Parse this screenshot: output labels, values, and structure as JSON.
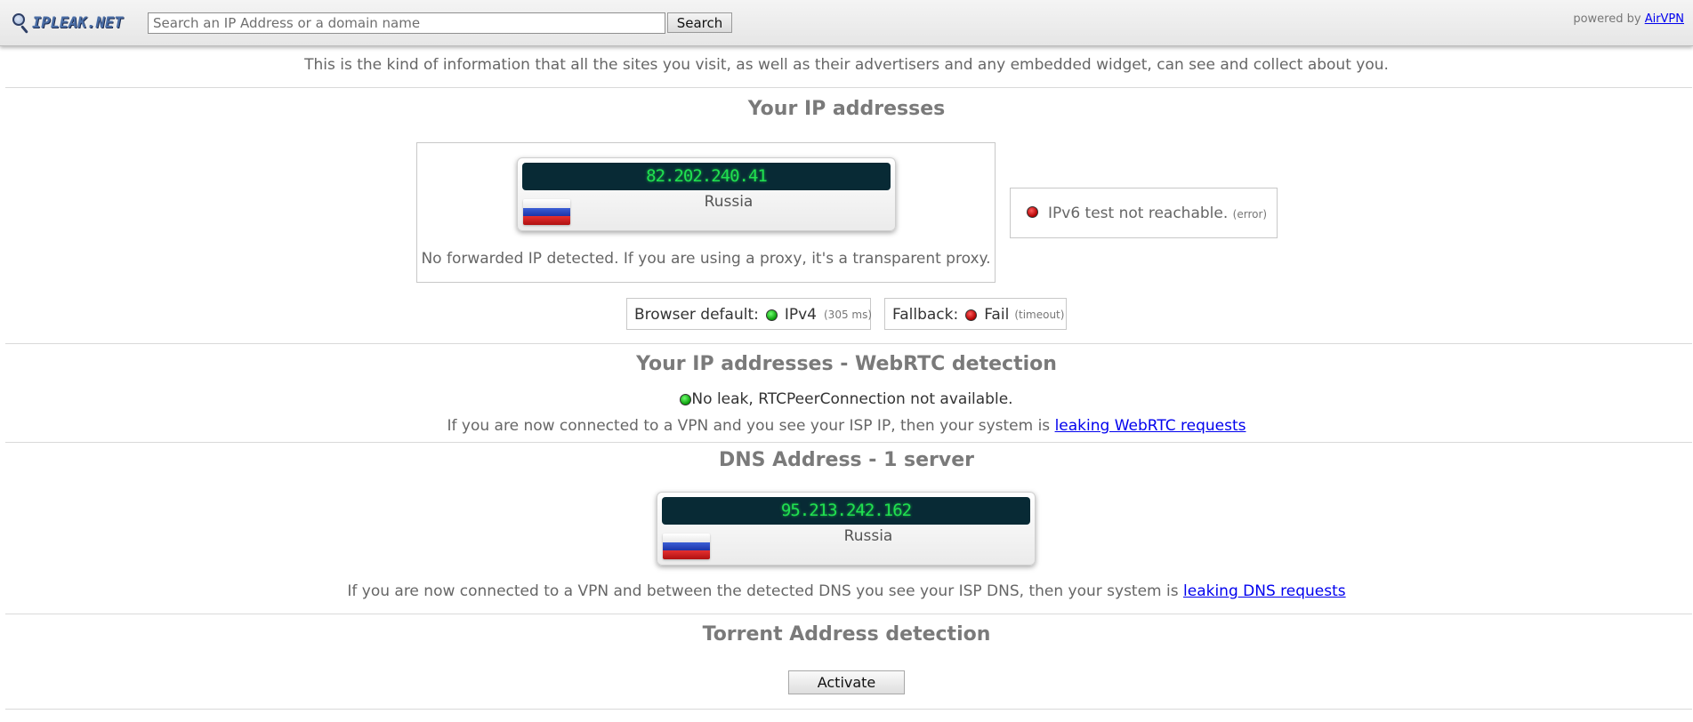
{
  "header": {
    "logo_text": "IPLEAK.NET",
    "search_placeholder": "Search an IP Address or a domain name",
    "search_button": "Search",
    "powered_by": "powered by",
    "powered_link": "AirVPN"
  },
  "intro": "This is the kind of information that all the sites you visit, as well as their advertisers and any embedded widget, can see and collect about you.",
  "ip_section": {
    "title": "Your IP addresses",
    "ip": "82.202.240.41",
    "country": "Russia",
    "flag": "russia-flag-icon",
    "no_forwarded": "No forwarded IP detected. If you are using a proxy, it's a transparent proxy.",
    "ipv6_text": "IPv6 test not reachable.",
    "ipv6_note": "(error)",
    "browser_default_label": "Browser default:",
    "browser_default_value": "IPv4",
    "browser_default_time": "(305 ms)",
    "fallback_label": "Fallback:",
    "fallback_value": "Fail",
    "fallback_note": "(timeout)"
  },
  "webrtc": {
    "title": "Your IP addresses - WebRTC detection",
    "status": "No leak, RTCPeerConnection not available.",
    "note": "If you are now connected to a VPN and you see your ISP IP, then your system is",
    "link": "leaking WebRTC requests"
  },
  "dns": {
    "title": "DNS Address - 1 server",
    "ip": "95.213.242.162",
    "country": "Russia",
    "note": "If you are now connected to a VPN and between the detected DNS you see your ISP DNS, then your system is",
    "link": "leaking DNS requests"
  },
  "torrent": {
    "title": "Torrent Address detection",
    "button": "Activate"
  },
  "colors": {
    "ok": "#0a9a0a",
    "error": "#b00000",
    "digital_bg": "#082a35",
    "digital_fg": "#20e050",
    "link": "#0000ee"
  }
}
